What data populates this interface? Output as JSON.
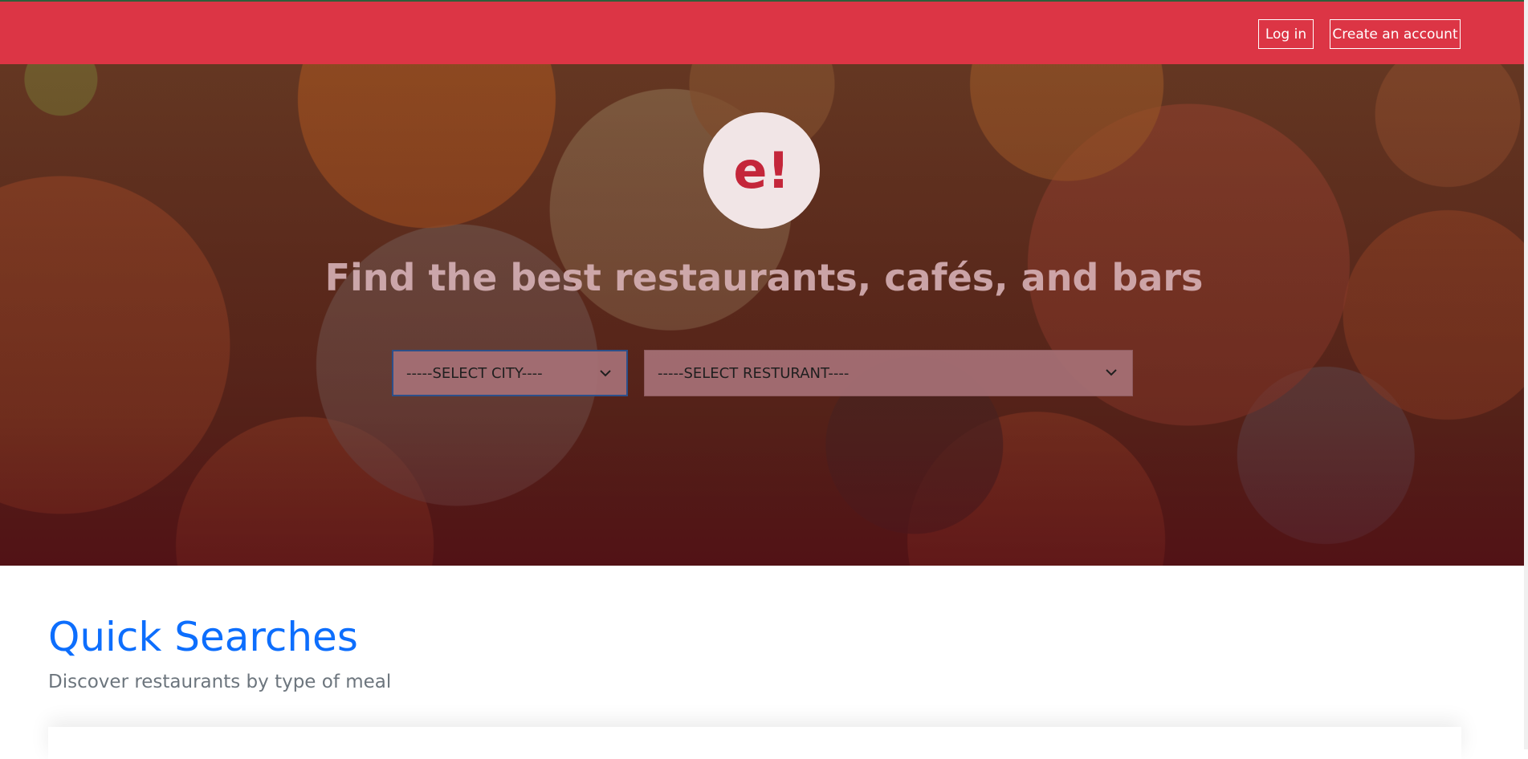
{
  "header": {
    "login_label": "Log in",
    "signup_label": "Create an account",
    "bg_color": "#dc3545"
  },
  "hero": {
    "logo_text": "e!",
    "title": "Find the best restaurants, cafés, and bars",
    "city_select": {
      "selected": "-----SELECT CITY----"
    },
    "restaurant_select": {
      "selected": "-----SELECT RESTURANT----"
    }
  },
  "quick_searches": {
    "title": "Quick Searches",
    "subtitle": "Discover restaurants by type of meal",
    "title_color": "#0d6efd"
  }
}
